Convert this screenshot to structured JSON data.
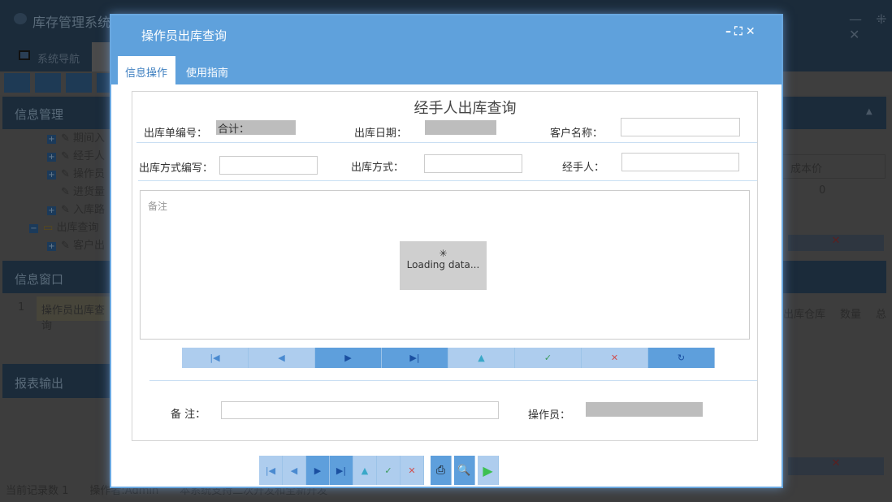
{
  "app": {
    "title": "库存管理系统",
    "tabs": [
      "系统导航"
    ],
    "window_controls": [
      "minimize",
      "restore",
      "close"
    ]
  },
  "left": {
    "info_mgmt": "信息管理",
    "tree": [
      "期间入",
      "经手人",
      "操作员",
      "进货量",
      "入库路",
      "出库查询",
      "客户出"
    ],
    "info_window": "信息窗口",
    "window_row": {
      "index": "1",
      "name": "操作员出库查询"
    },
    "report": "报表输出"
  },
  "right": {
    "col_cost": "成本价",
    "cost_value": "0",
    "cols2": [
      "出库仓库",
      "数量",
      "总"
    ]
  },
  "status": {
    "record_count": "当前记录数 1",
    "operator": "操作者:Admin",
    "note": "本系统支持二次开发和全新开发"
  },
  "dialog": {
    "title": "操作员出库查询",
    "tabs": [
      "信息操作",
      "使用指南"
    ],
    "active_tab": 0,
    "form": {
      "heading": "经手人出库查询",
      "order_no_label": "出库单编号：",
      "order_no_value": "合计：",
      "date_label": "出库日期：",
      "customer_label": "客户名称：",
      "method_abbr_label": "出库方式编写：",
      "method_label": "出库方式：",
      "handler_label": "经手人：",
      "grid_header": "备注",
      "loading": "Loading data...",
      "remark_label": "备  注：",
      "operator_label": "操作员："
    }
  },
  "colors": {
    "accent": "#5fa1dc",
    "dark": "#1b2b3a"
  }
}
